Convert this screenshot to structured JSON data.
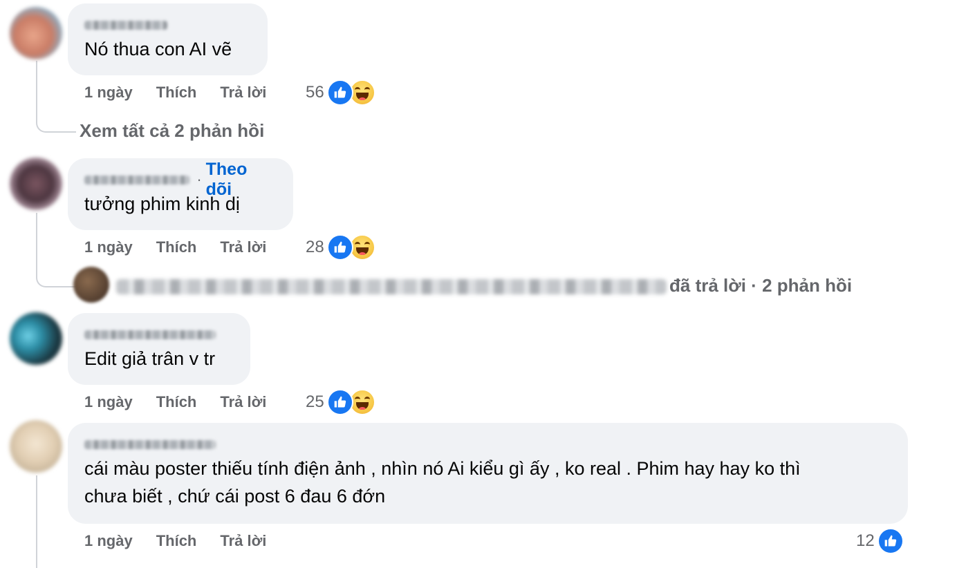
{
  "comments": [
    {
      "text": "Nó thua con AI vẽ",
      "time": "1 ngày",
      "like_label": "Thích",
      "reply_label": "Trả lời",
      "reaction_count": "56",
      "reactions": [
        "like-icon",
        "haha-icon"
      ]
    },
    {
      "follow_label": "Theo dõi",
      "text": "tưởng phim kinh dị",
      "time": "1 ngày",
      "like_label": "Thích",
      "reply_label": "Trả lời",
      "reaction_count": "28",
      "reactions": [
        "like-icon",
        "haha-icon"
      ]
    },
    {
      "text": "Edit giả trân v tr",
      "time": "1 ngày",
      "like_label": "Thích",
      "reply_label": "Trả lời",
      "reaction_count": "25",
      "reactions": [
        "like-icon",
        "haha-icon"
      ]
    },
    {
      "text_line1": "cái màu poster thiếu tính điện ảnh , nhìn nó Ai kiểu gì ấy , ko real . Phim hay hay ko thì",
      "text_line2": "chưa biết , chứ cái post 6 đau 6 đớn",
      "time": "1 ngày",
      "like_label": "Thích",
      "reply_label": "Trả lời",
      "reaction_count": "12",
      "reactions": [
        "like-icon"
      ]
    }
  ],
  "view_replies_1": "Xem tất cả 2 phản hồi",
  "replied_summary": "đã trả lời · 2 phản hồi",
  "colors": {
    "bubble": "#f0f2f5",
    "meta_text": "#65676b",
    "follow": "#0064d1",
    "like": "#1877f2"
  }
}
